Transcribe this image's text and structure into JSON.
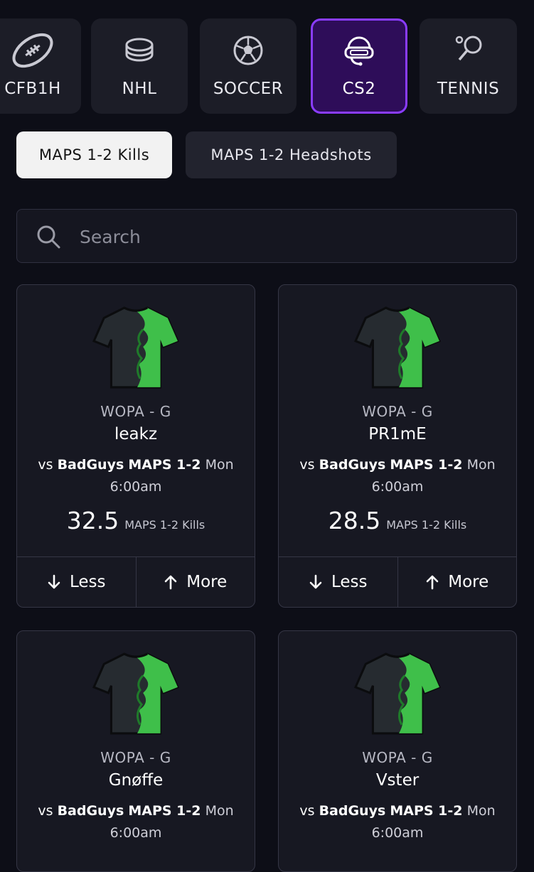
{
  "sport_tabs": [
    {
      "label": "CFB1H",
      "icon": "football-icon"
    },
    {
      "label": "NHL",
      "icon": "hockey-puck-icon"
    },
    {
      "label": "SOCCER",
      "icon": "soccer-ball-icon"
    },
    {
      "label": "CS2",
      "icon": "gamer-headset-icon",
      "active": true
    },
    {
      "label": "TENNIS",
      "icon": "tennis-racket-icon"
    }
  ],
  "stat_chips": [
    {
      "label": "MAPS 1-2 Kills",
      "selected": true
    },
    {
      "label": "MAPS 1-2 Headshots",
      "selected": false
    }
  ],
  "search": {
    "placeholder": "Search",
    "value": ""
  },
  "cards": [
    {
      "team": "WOPA - G",
      "player": "leakz",
      "vs": "vs",
      "opponent": "BadGuys",
      "maps": "MAPS 1-2",
      "day": "Mon",
      "time": "6:00am",
      "line": "32.5",
      "stat": "MAPS 1-2 Kills",
      "less": "Less",
      "more": "More"
    },
    {
      "team": "WOPA - G",
      "player": "PR1mE",
      "vs": "vs",
      "opponent": "BadGuys",
      "maps": "MAPS 1-2",
      "day": "Mon",
      "time": "6:00am",
      "line": "28.5",
      "stat": "MAPS 1-2 Kills",
      "less": "Less",
      "more": "More"
    },
    {
      "team": "WOPA - G",
      "player": "Gnøffe",
      "vs": "vs",
      "opponent": "BadGuys",
      "maps": "MAPS 1-2",
      "day": "Mon",
      "time": "6:00am"
    },
    {
      "team": "WOPA - G",
      "player": "Vster",
      "vs": "vs",
      "opponent": "BadGuys",
      "maps": "MAPS 1-2",
      "day": "Mon",
      "time": "6:00am"
    }
  ],
  "colors": {
    "background": "#0d0e17",
    "accent": "#8a3cff",
    "active_tab_bg": "#2e0d59",
    "jersey_green": "#3fbf4a",
    "jersey_dark": "#262b30"
  }
}
